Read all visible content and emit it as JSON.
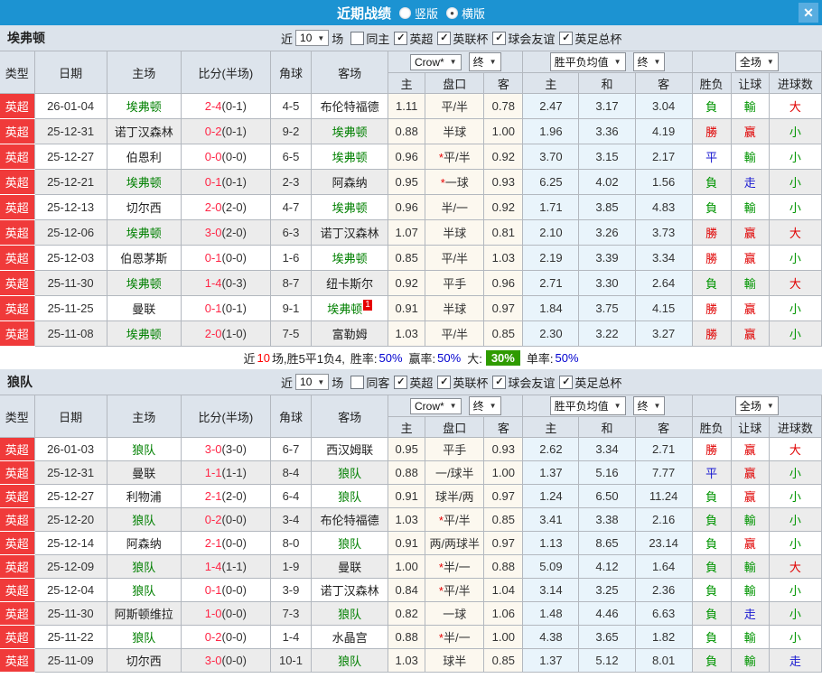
{
  "icons": {
    "dropdown_arrow": "▼",
    "close": "✕",
    "radio_dot_on": "●",
    "radio_dot_off": ""
  },
  "titlebar": {
    "title": "近期战绩",
    "radios": [
      {
        "label": "竖版",
        "dot": ""
      },
      {
        "label": "横版",
        "dot": "●"
      }
    ]
  },
  "columns": {
    "type": "类型",
    "date": "日期",
    "home": "主场",
    "score": "比分(半场)",
    "corner": "角球",
    "away": "客场",
    "crow": "Crow*",
    "final": "终",
    "avg": "胜平负均值",
    "full": "全场",
    "sub_home": "主",
    "sub_handicap": "盘口",
    "sub_away": "客",
    "sub_avg_home": "主",
    "sub_avg_draw": "和",
    "sub_avg_away": "客",
    "sub_wdl": "胜负",
    "sub_let": "让球",
    "sub_goals": "进球数"
  },
  "sections": [
    {
      "team": "埃弗顿",
      "filter": {
        "near": "近",
        "count": "10",
        "unit": "场",
        "checks": [
          {
            "label": "同主",
            "mark": ""
          },
          {
            "label": "英超",
            "mark": "✓"
          },
          {
            "label": "英联杯",
            "mark": "✓"
          },
          {
            "label": "球会友谊",
            "mark": "✓"
          },
          {
            "label": "英足总杯",
            "mark": "✓"
          }
        ]
      },
      "rows": [
        {
          "l": "英超",
          "d": "26-01-04",
          "h": "埃弗顿",
          "hh": true,
          "sf": "2-4",
          "sh": "(0-1)",
          "c": "4-5",
          "a": "布伦特福德",
          "ah": false,
          "ab": "",
          "o1": "1.11",
          "st": "",
          "hc": "平/半",
          "o2": "0.78",
          "m1": "2.47",
          "m2": "3.17",
          "m3": "3.04",
          "r1": "負",
          "c1": "g",
          "r2": "輸",
          "c2": "g",
          "r3": "大",
          "c3": "r"
        },
        {
          "l": "英超",
          "d": "25-12-31",
          "h": "诺丁汉森林",
          "hh": false,
          "sf": "0-2",
          "sh": "(0-1)",
          "c": "9-2",
          "a": "埃弗顿",
          "ah": true,
          "ab": "",
          "o1": "0.88",
          "st": "",
          "hc": "半球",
          "o2": "1.00",
          "m1": "1.96",
          "m2": "3.36",
          "m3": "4.19",
          "r1": "勝",
          "c1": "r",
          "r2": "赢",
          "c2": "r",
          "r3": "小",
          "c3": "g"
        },
        {
          "l": "英超",
          "d": "25-12-27",
          "h": "伯恩利",
          "hh": false,
          "sf": "0-0",
          "sh": "(0-0)",
          "c": "6-5",
          "a": "埃弗顿",
          "ah": true,
          "ab": "",
          "o1": "0.96",
          "st": "*",
          "hc": "平/半",
          "o2": "0.92",
          "m1": "3.70",
          "m2": "3.15",
          "m3": "2.17",
          "r1": "平",
          "c1": "b",
          "r2": "輸",
          "c2": "g",
          "r3": "小",
          "c3": "g"
        },
        {
          "l": "英超",
          "d": "25-12-21",
          "h": "埃弗顿",
          "hh": true,
          "sf": "0-1",
          "sh": "(0-1)",
          "c": "2-3",
          "a": "阿森纳",
          "ah": false,
          "ab": "",
          "o1": "0.95",
          "st": "*",
          "hc": "一球",
          "o2": "0.93",
          "m1": "6.25",
          "m2": "4.02",
          "m3": "1.56",
          "r1": "負",
          "c1": "g",
          "r2": "走",
          "c2": "b",
          "r3": "小",
          "c3": "g"
        },
        {
          "l": "英超",
          "d": "25-12-13",
          "h": "切尔西",
          "hh": false,
          "sf": "2-0",
          "sh": "(2-0)",
          "c": "4-7",
          "a": "埃弗顿",
          "ah": true,
          "ab": "",
          "o1": "0.96",
          "st": "",
          "hc": "半/一",
          "o2": "0.92",
          "m1": "1.71",
          "m2": "3.85",
          "m3": "4.83",
          "r1": "負",
          "c1": "g",
          "r2": "輸",
          "c2": "g",
          "r3": "小",
          "c3": "g"
        },
        {
          "l": "英超",
          "d": "25-12-06",
          "h": "埃弗顿",
          "hh": true,
          "sf": "3-0",
          "sh": "(2-0)",
          "c": "6-3",
          "a": "诺丁汉森林",
          "ah": false,
          "ab": "",
          "o1": "1.07",
          "st": "",
          "hc": "半球",
          "o2": "0.81",
          "m1": "2.10",
          "m2": "3.26",
          "m3": "3.73",
          "r1": "勝",
          "c1": "r",
          "r2": "赢",
          "c2": "r",
          "r3": "大",
          "c3": "r"
        },
        {
          "l": "英超",
          "d": "25-12-03",
          "h": "伯恩茅斯",
          "hh": false,
          "sf": "0-1",
          "sh": "(0-0)",
          "c": "1-6",
          "a": "埃弗顿",
          "ah": true,
          "ab": "",
          "o1": "0.85",
          "st": "",
          "hc": "平/半",
          "o2": "1.03",
          "m1": "2.19",
          "m2": "3.39",
          "m3": "3.34",
          "r1": "勝",
          "c1": "r",
          "r2": "赢",
          "c2": "r",
          "r3": "小",
          "c3": "g"
        },
        {
          "l": "英超",
          "d": "25-11-30",
          "h": "埃弗顿",
          "hh": true,
          "sf": "1-4",
          "sh": "(0-3)",
          "c": "8-7",
          "a": "纽卡斯尔",
          "ah": false,
          "ab": "",
          "o1": "0.92",
          "st": "",
          "hc": "平手",
          "o2": "0.96",
          "m1": "2.71",
          "m2": "3.30",
          "m3": "2.64",
          "r1": "負",
          "c1": "g",
          "r2": "輸",
          "c2": "g",
          "r3": "大",
          "c3": "r"
        },
        {
          "l": "英超",
          "d": "25-11-25",
          "h": "曼联",
          "hh": false,
          "sf": "0-1",
          "sh": "(0-1)",
          "c": "9-1",
          "a": "埃弗顿",
          "ah": true,
          "ab": "1",
          "o1": "0.91",
          "st": "",
          "hc": "半球",
          "o2": "0.97",
          "m1": "1.84",
          "m2": "3.75",
          "m3": "4.15",
          "r1": "勝",
          "c1": "r",
          "r2": "赢",
          "c2": "r",
          "r3": "小",
          "c3": "g"
        },
        {
          "l": "英超",
          "d": "25-11-08",
          "h": "埃弗顿",
          "hh": true,
          "sf": "2-0",
          "sh": "(1-0)",
          "c": "7-5",
          "a": "富勒姆",
          "ah": false,
          "ab": "",
          "o1": "1.03",
          "st": "",
          "hc": "平/半",
          "o2": "0.85",
          "m1": "2.30",
          "m2": "3.22",
          "m3": "3.27",
          "r1": "勝",
          "c1": "r",
          "r2": "赢",
          "c2": "r",
          "r3": "小",
          "c3": "g"
        }
      ],
      "summary": {
        "pre": "近",
        "n": "10",
        "rest": "场,胜5平1负4,",
        "l1": "胜率:",
        "v1": "50%",
        "l2": "赢率:",
        "v2": "50%",
        "l3": "大:",
        "hv": "30%",
        "l4": "单率:",
        "v4": "50%"
      }
    },
    {
      "team": "狼队",
      "filter": {
        "near": "近",
        "count": "10",
        "unit": "场",
        "checks": [
          {
            "label": "同客",
            "mark": ""
          },
          {
            "label": "英超",
            "mark": "✓"
          },
          {
            "label": "英联杯",
            "mark": "✓"
          },
          {
            "label": "球会友谊",
            "mark": "✓"
          },
          {
            "label": "英足总杯",
            "mark": "✓"
          }
        ]
      },
      "rows": [
        {
          "l": "英超",
          "d": "26-01-03",
          "h": "狼队",
          "hh": true,
          "sf": "3-0",
          "sh": "(3-0)",
          "c": "6-7",
          "a": "西汉姆联",
          "ah": false,
          "ab": "",
          "o1": "0.95",
          "st": "",
          "hc": "平手",
          "o2": "0.93",
          "m1": "2.62",
          "m2": "3.34",
          "m3": "2.71",
          "r1": "勝",
          "c1": "r",
          "r2": "赢",
          "c2": "r",
          "r3": "大",
          "c3": "r"
        },
        {
          "l": "英超",
          "d": "25-12-31",
          "h": "曼联",
          "hh": false,
          "sf": "1-1",
          "sh": "(1-1)",
          "c": "8-4",
          "a": "狼队",
          "ah": true,
          "ab": "",
          "o1": "0.88",
          "st": "",
          "hc": "一/球半",
          "o2": "1.00",
          "m1": "1.37",
          "m2": "5.16",
          "m3": "7.77",
          "r1": "平",
          "c1": "b",
          "r2": "赢",
          "c2": "r",
          "r3": "小",
          "c3": "g"
        },
        {
          "l": "英超",
          "d": "25-12-27",
          "h": "利物浦",
          "hh": false,
          "sf": "2-1",
          "sh": "(2-0)",
          "c": "6-4",
          "a": "狼队",
          "ah": true,
          "ab": "",
          "o1": "0.91",
          "st": "",
          "hc": "球半/两",
          "o2": "0.97",
          "m1": "1.24",
          "m2": "6.50",
          "m3": "11.24",
          "r1": "負",
          "c1": "g",
          "r2": "赢",
          "c2": "r",
          "r3": "小",
          "c3": "g"
        },
        {
          "l": "英超",
          "d": "25-12-20",
          "h": "狼队",
          "hh": true,
          "sf": "0-2",
          "sh": "(0-0)",
          "c": "3-4",
          "a": "布伦特福德",
          "ah": false,
          "ab": "",
          "o1": "1.03",
          "st": "*",
          "hc": "平/半",
          "o2": "0.85",
          "m1": "3.41",
          "m2": "3.38",
          "m3": "2.16",
          "r1": "負",
          "c1": "g",
          "r2": "輸",
          "c2": "g",
          "r3": "小",
          "c3": "g"
        },
        {
          "l": "英超",
          "d": "25-12-14",
          "h": "阿森纳",
          "hh": false,
          "sf": "2-1",
          "sh": "(0-0)",
          "c": "8-0",
          "a": "狼队",
          "ah": true,
          "ab": "",
          "o1": "0.91",
          "st": "",
          "hc": "两/两球半",
          "o2": "0.97",
          "m1": "1.13",
          "m2": "8.65",
          "m3": "23.14",
          "r1": "負",
          "c1": "g",
          "r2": "赢",
          "c2": "r",
          "r3": "小",
          "c3": "g"
        },
        {
          "l": "英超",
          "d": "25-12-09",
          "h": "狼队",
          "hh": true,
          "sf": "1-4",
          "sh": "(1-1)",
          "c": "1-9",
          "a": "曼联",
          "ah": false,
          "ab": "",
          "o1": "1.00",
          "st": "*",
          "hc": "半/一",
          "o2": "0.88",
          "m1": "5.09",
          "m2": "4.12",
          "m3": "1.64",
          "r1": "負",
          "c1": "g",
          "r2": "輸",
          "c2": "g",
          "r3": "大",
          "c3": "r"
        },
        {
          "l": "英超",
          "d": "25-12-04",
          "h": "狼队",
          "hh": true,
          "sf": "0-1",
          "sh": "(0-0)",
          "c": "3-9",
          "a": "诺丁汉森林",
          "ah": false,
          "ab": "",
          "o1": "0.84",
          "st": "*",
          "hc": "平/半",
          "o2": "1.04",
          "m1": "3.14",
          "m2": "3.25",
          "m3": "2.36",
          "r1": "負",
          "c1": "g",
          "r2": "輸",
          "c2": "g",
          "r3": "小",
          "c3": "g"
        },
        {
          "l": "英超",
          "d": "25-11-30",
          "h": "阿斯顿维拉",
          "hh": false,
          "sf": "1-0",
          "sh": "(0-0)",
          "c": "7-3",
          "a": "狼队",
          "ah": true,
          "ab": "",
          "o1": "0.82",
          "st": "",
          "hc": "一球",
          "o2": "1.06",
          "m1": "1.48",
          "m2": "4.46",
          "m3": "6.63",
          "r1": "負",
          "c1": "g",
          "r2": "走",
          "c2": "b",
          "r3": "小",
          "c3": "g"
        },
        {
          "l": "英超",
          "d": "25-11-22",
          "h": "狼队",
          "hh": true,
          "sf": "0-2",
          "sh": "(0-0)",
          "c": "1-4",
          "a": "水晶宫",
          "ah": false,
          "ab": "",
          "o1": "0.88",
          "st": "*",
          "hc": "半/一",
          "o2": "1.00",
          "m1": "4.38",
          "m2": "3.65",
          "m3": "1.82",
          "r1": "負",
          "c1": "g",
          "r2": "輸",
          "c2": "g",
          "r3": "小",
          "c3": "g"
        },
        {
          "l": "英超",
          "d": "25-11-09",
          "h": "切尔西",
          "hh": false,
          "sf": "3-0",
          "sh": "(0-0)",
          "c": "10-1",
          "a": "狼队",
          "ah": true,
          "ab": "",
          "o1": "1.03",
          "st": "",
          "hc": "球半",
          "o2": "0.85",
          "m1": "1.37",
          "m2": "5.12",
          "m3": "8.01",
          "r1": "負",
          "c1": "g",
          "r2": "輸",
          "c2": "g",
          "r3": "走",
          "c3": "b"
        }
      ]
    }
  ]
}
